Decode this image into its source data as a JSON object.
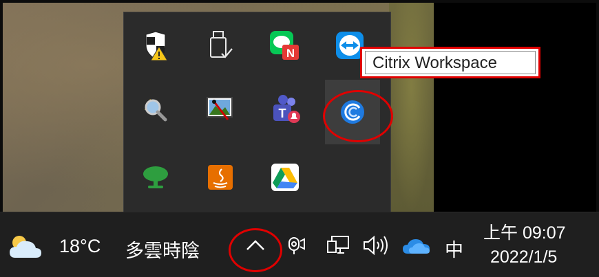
{
  "tooltip": {
    "text": "Citrix Workspace"
  },
  "tray_icons": [
    {
      "name": "windows-security-icon",
      "label": "Windows Security"
    },
    {
      "name": "usb-safely-remove-icon",
      "label": "Safely Remove Hardware"
    },
    {
      "name": "line-icon",
      "label": "LINE"
    },
    {
      "name": "teamviewer-icon",
      "label": "TeamViewer"
    },
    {
      "name": "magnifier-tool-icon",
      "label": "Search tool"
    },
    {
      "name": "snipping-tool-icon",
      "label": "Screen capture"
    },
    {
      "name": "teams-icon",
      "label": "Microsoft Teams"
    },
    {
      "name": "citrix-workspace-icon",
      "label": "Citrix Workspace"
    },
    {
      "name": "green-tree-icon",
      "label": "App"
    },
    {
      "name": "java-update-icon",
      "label": "Java Update"
    },
    {
      "name": "google-drive-icon",
      "label": "Google Drive"
    }
  ],
  "taskbar": {
    "weather": {
      "temperature": "18°C",
      "condition": "多雲時陰"
    },
    "ime": "中",
    "clock": {
      "time": "上午 09:07",
      "date": "2022/1/5"
    }
  },
  "colors": {
    "highlight": "#e00000",
    "taskbar": "#1f1f1f",
    "flyout": "#2b2b2b"
  }
}
